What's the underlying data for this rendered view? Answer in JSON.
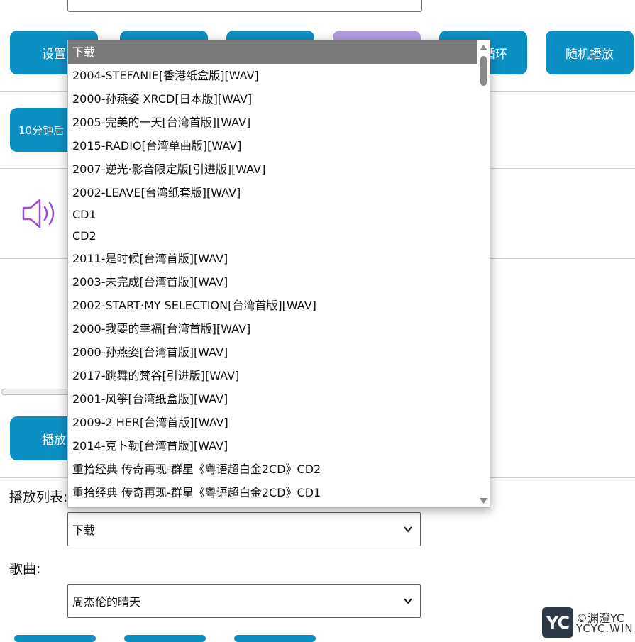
{
  "controls": {
    "settings_label": "设置",
    "loop_label": "循环",
    "shuffle_label": "随机播放",
    "timer_label": "10分钟后",
    "play_label": "播放"
  },
  "playlist": {
    "label": "播放列表:",
    "selected": "下载",
    "options": [
      "下载",
      "2004-STEFANIE[香港纸盒版][WAV]",
      "2000-孙燕姿 XRCD[日本版][WAV]",
      "2005-完美的一天[台湾首版][WAV]",
      "2015-RADIO[台湾单曲版][WAV]",
      "2007-逆光·影音限定版[引进版][WAV]",
      "2002-LEAVE[台湾纸套版][WAV]",
      "CD1",
      "CD2",
      "2011-是时候[台湾首版][WAV]",
      "2003-未完成[台湾首版][WAV]",
      "2002-START·MY SELECTION[台湾首版][WAV]",
      "2000-我要的幸福[台湾首版][WAV]",
      "2000-孙燕姿[台湾首版][WAV]",
      "2017-跳舞的梵谷[引进版][WAV]",
      "2001-风筝[台湾纸盒版][WAV]",
      "2009-2 HER[台湾首版][WAV]",
      "2014-克卜勒[台湾首版][WAV]",
      "重拾经典 传奇再现-群星《粤语超白金2CD》CD2",
      "重拾经典 传奇再现-群星《粤语超白金2CD》CD1"
    ]
  },
  "song": {
    "label": "歌曲:",
    "selected": "周杰伦的晴天"
  },
  "watermark": {
    "logo": "YC",
    "line1": "©渊澄YC",
    "line2": "YCYC.WIN"
  },
  "colors": {
    "button": "#0c8fc3",
    "button_active": "#b39ddb",
    "speaker": "#9b4fd6",
    "selected_option": "#7a7a7a"
  }
}
